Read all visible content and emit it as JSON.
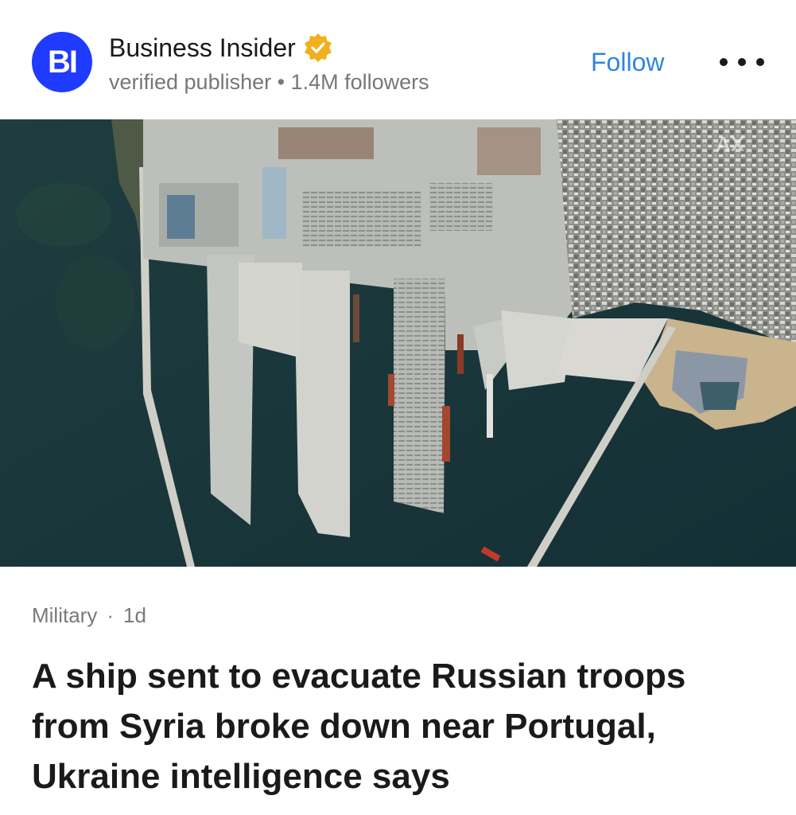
{
  "publisher": {
    "logo_text": "BI",
    "name": "Business Insider",
    "verified_badge_icon": "verified-check-icon",
    "subtitle": "verified publisher",
    "separator": "•",
    "followers": "1.4M followers",
    "follow_label": "Follow",
    "more_icon": "more-options-icon"
  },
  "hero": {
    "description_icon": "satellite-photo",
    "watermark": "AX"
  },
  "article": {
    "category": "Military",
    "separator": "·",
    "age": "1d",
    "headline": "A ship sent to evacuate Russian troops from Syria broke down near Portugal, Ukraine intelligence says"
  },
  "colors": {
    "logo_bg": "#1f3bff",
    "follow": "#2f86df",
    "badge": "#f2b01e",
    "sea": "#17343b",
    "concrete": "#c9ccca"
  }
}
